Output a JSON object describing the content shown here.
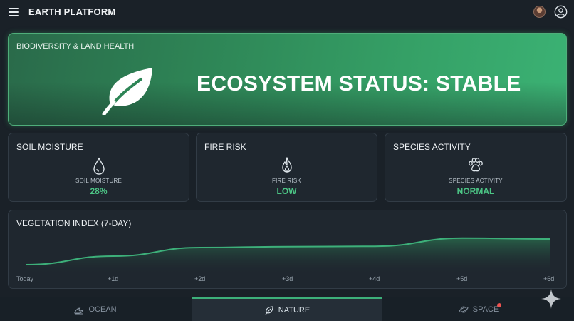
{
  "app": {
    "title": "EARTH PLATFORM"
  },
  "hero": {
    "label": "BIODIVERSITY & LAND HEALTH",
    "status": "ECOSYSTEM STATUS: STABLE",
    "icon": "leaf-icon"
  },
  "cards": [
    {
      "title": "SOIL MOISTURE",
      "sub": "SOIL MOISTURE",
      "value": "28%",
      "icon": "water-drop-icon"
    },
    {
      "title": "FIRE RISK",
      "sub": "FIRE RISK",
      "value": "LOW",
      "icon": "flame-icon"
    },
    {
      "title": "SPECIES ACTIVITY",
      "sub": "SPECIES ACTIVITY",
      "value": "NORMAL",
      "icon": "paw-icon"
    }
  ],
  "vegetation": {
    "title": "VEGETATION INDEX (7-DAY)",
    "ticks": [
      "Today",
      "+1d",
      "+2d",
      "+3d",
      "+4d",
      "+5d",
      "+6d"
    ]
  },
  "chart_data": {
    "type": "area",
    "x": [
      "Today",
      "+1d",
      "+2d",
      "+3d",
      "+4d",
      "+5d",
      "+6d"
    ],
    "values": [
      0.2,
      0.4,
      0.6,
      0.62,
      0.63,
      0.82,
      0.8
    ],
    "color": "#3db07a",
    "grid": false
  },
  "nav": {
    "tabs": [
      {
        "label": "OCEAN",
        "icon": "wave-icon",
        "active": false
      },
      {
        "label": "NATURE",
        "icon": "leaf-icon",
        "active": true
      },
      {
        "label": "SPACE",
        "icon": "planet-icon",
        "active": false,
        "notification": true
      }
    ]
  },
  "colors": {
    "accent": "#4cc585",
    "hero": "#35a066",
    "background": "#1a2128"
  }
}
